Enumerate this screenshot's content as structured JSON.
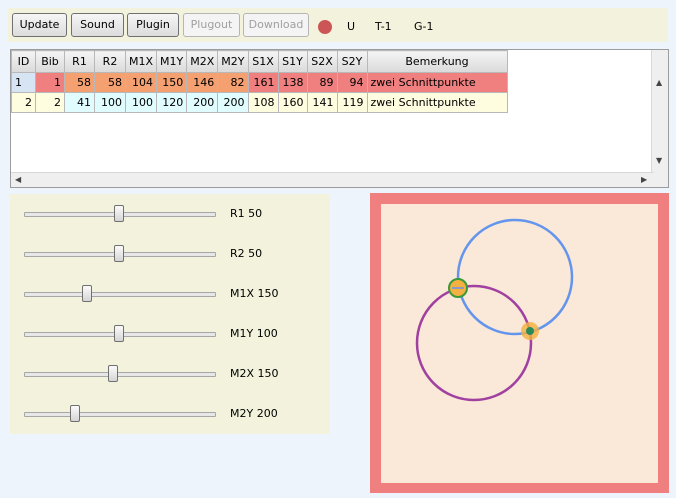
{
  "toolbar": {
    "buttons": [
      {
        "label": "Update",
        "enabled": true
      },
      {
        "label": "Sound",
        "enabled": true
      },
      {
        "label": "Plugin",
        "enabled": true
      },
      {
        "label": "Plugout",
        "enabled": false
      },
      {
        "label": "Download",
        "enabled": false
      }
    ],
    "status_color": "#cc5555",
    "status_texts": [
      "U",
      "T-1",
      "G-1"
    ]
  },
  "grid": {
    "columns": [
      "ID",
      "Bib",
      "R1",
      "R2",
      "M1X",
      "M1Y",
      "M2X",
      "M2Y",
      "S1X",
      "S1Y",
      "S2X",
      "S2Y",
      "Bemerkung"
    ],
    "rows": [
      [
        "1",
        "1",
        "58",
        "58",
        "104",
        "150",
        "146",
        "82",
        "161",
        "138",
        "89",
        "94",
        "zwei Schnittpunkte"
      ],
      [
        "2",
        "2",
        "41",
        "100",
        "100",
        "120",
        "200",
        "200",
        "108",
        "160",
        "141",
        "119",
        "zwei Schnittpunkte"
      ]
    ],
    "row_colors": {
      "row1": "#f08080",
      "row1_accent": "#f4a070",
      "row2": "#fffde0",
      "row2_accent": "#e0fcff"
    }
  },
  "sliders": [
    {
      "name": "R1",
      "label": "R1 50",
      "value": 50,
      "min": 0,
      "max": 100
    },
    {
      "name": "R2",
      "label": "R2 50",
      "value": 50,
      "min": 0,
      "max": 100
    },
    {
      "name": "M1X",
      "label": "M1X 150",
      "value": 150,
      "min": 0,
      "max": 450
    },
    {
      "name": "M1Y",
      "label": "M1Y 100",
      "value": 100,
      "min": 0,
      "max": 200
    },
    {
      "name": "M2X",
      "label": "M2X 150",
      "value": 150,
      "min": 0,
      "max": 320
    },
    {
      "name": "M2Y",
      "label": "M2Y 200",
      "value": 200,
      "min": 0,
      "max": 750
    }
  ],
  "canvas": {
    "border_color": "#f08080",
    "background": "#fae8d8",
    "circle1_color": "#6495ed",
    "circle2_color": "#a040a0",
    "intersection1_color": "#f4b040",
    "intersection2_color": "#f4b040"
  }
}
